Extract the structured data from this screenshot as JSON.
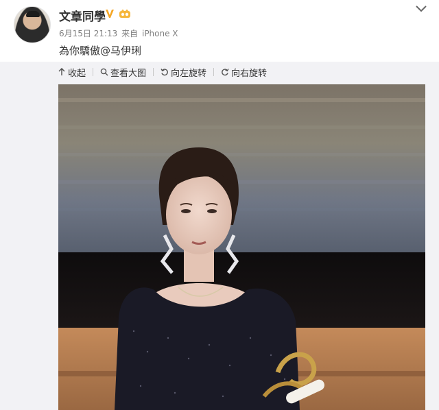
{
  "post": {
    "username": "文章同學",
    "verified_badge": "V",
    "member_badge": "weibo-member-icon",
    "timestamp": "6月15日 21:13",
    "source_prefix": "来自",
    "source_device": "iPhone X",
    "text": "為你驕傲@马伊琍"
  },
  "toolbar": {
    "collapse": "收起",
    "view_large": "查看大图",
    "rotate_left": "向左旋转",
    "rotate_right": "向右旋转"
  },
  "colors": {
    "verified": "#f5a623",
    "member": "#f6b73c",
    "toolbar_bg": "#f2f2f5"
  }
}
